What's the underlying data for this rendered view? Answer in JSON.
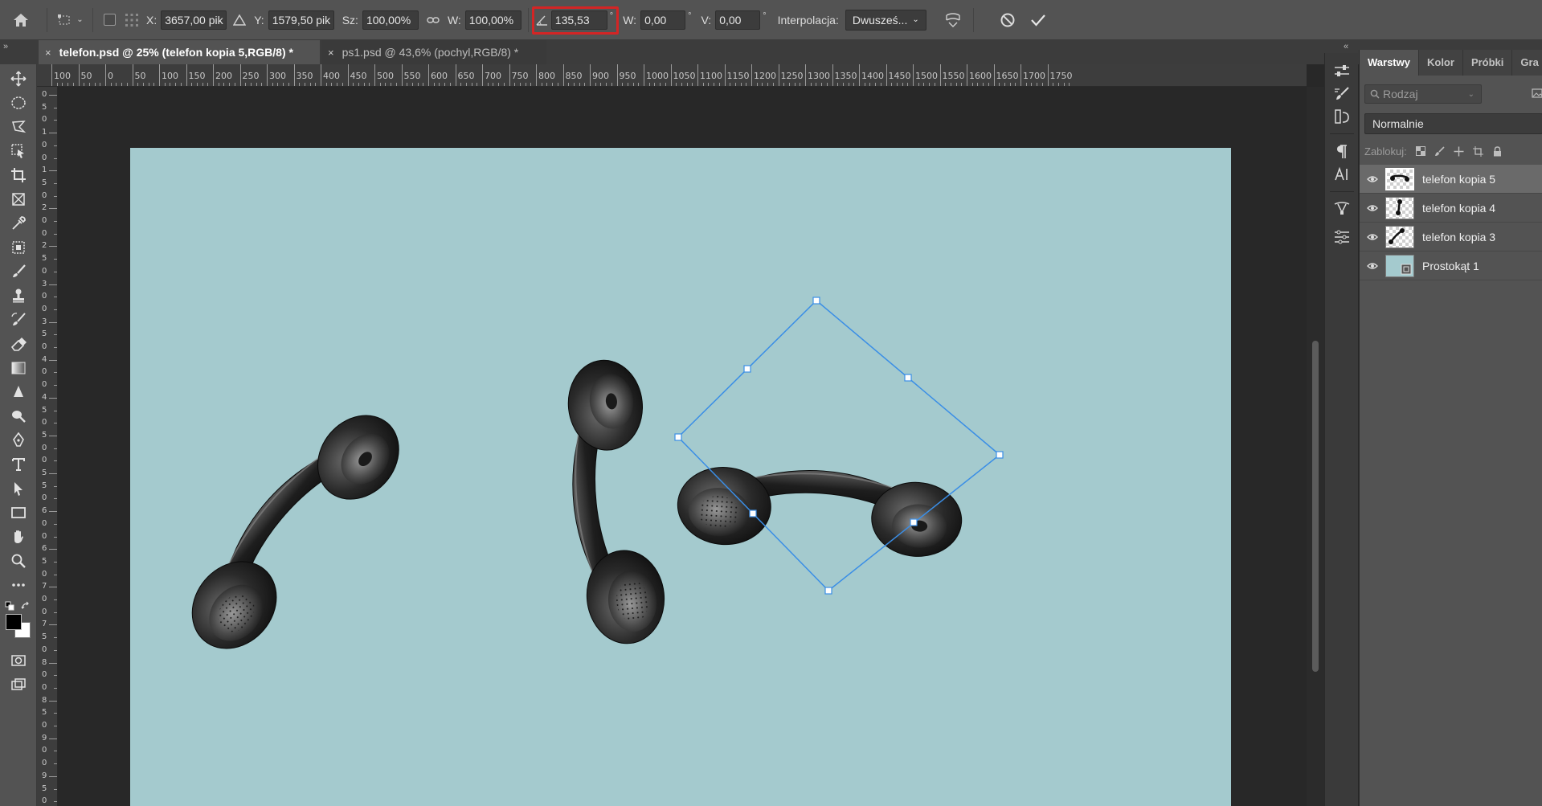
{
  "options_bar": {
    "x_label": "X:",
    "x_value": "3657,00 pik",
    "y_label": "Y:",
    "y_value": "1579,50 pik",
    "width_label": "Sz:",
    "width_value": "100,00%",
    "height_label": "W:",
    "height_value": "100,00%",
    "angle_value": "135,53",
    "angle_unit": "°",
    "hskew_label": "W:",
    "hskew_value": "0,00",
    "hskew_unit": "°",
    "vskew_label": "V:",
    "vskew_value": "0,00",
    "vskew_unit": "°",
    "interpolation_label": "Interpolacja:",
    "interpolation_value": "Dwusześ...",
    "highlight_color": "#d42525"
  },
  "tabs": [
    {
      "close": "×",
      "label": "telefon.psd @ 25% (telefon kopia 5,RGB/8) *",
      "active": true
    },
    {
      "close": "×",
      "label": "ps1.psd @ 43,6% (pochyl,RGB/8) *",
      "active": false
    }
  ],
  "ruler_top": [
    "100",
    "50",
    "0",
    "50",
    "100",
    "150",
    "200",
    "250",
    "300",
    "350",
    "400",
    "450",
    "500",
    "550",
    "600",
    "650",
    "700",
    "750",
    "800",
    "850",
    "900",
    "950",
    "1000",
    "1050",
    "1100",
    "1150",
    "1200",
    "1250",
    "1300",
    "1350",
    "1400",
    "1450",
    "1500",
    "1550",
    "1600",
    "1650",
    "1700",
    "1750"
  ],
  "ruler_left": [
    "0",
    "5",
    "0",
    "1",
    "0",
    "0",
    "1",
    "5",
    "0",
    "2",
    "0",
    "0",
    "2",
    "5",
    "0",
    "3",
    "0",
    "0",
    "3",
    "5",
    "0",
    "4",
    "0",
    "0",
    "4",
    "5",
    "0",
    "5",
    "0",
    "0",
    "5",
    "5",
    "0",
    "6",
    "0",
    "0",
    "6",
    "5",
    "0",
    "7",
    "0",
    "0",
    "7",
    "5",
    "0",
    "8",
    "0",
    "0",
    "8",
    "5",
    "0",
    "9",
    "0",
    "0",
    "9",
    "5",
    "0"
  ],
  "canvas": {
    "background": "#a4cace",
    "selection_color": "#3a8ee6"
  },
  "panel": {
    "tabs": [
      "Warstwy",
      "Kolor",
      "Próbki",
      "Gra"
    ],
    "filter_placeholder": "Rodzaj",
    "blend_mode": "Normalnie",
    "lock_label": "Zablokuj:",
    "layers": [
      {
        "name": "telefon kopia 5",
        "selected": true
      },
      {
        "name": "telefon kopia 4",
        "selected": false
      },
      {
        "name": "telefon kopia 3",
        "selected": false
      },
      {
        "name": "Prostokąt 1",
        "selected": false
      }
    ]
  },
  "tools": [
    "move-tool-icon",
    "ellipse-marquee-icon",
    "lasso-icon",
    "object-select-icon",
    "crop-icon",
    "frame-icon",
    "eyedropper-icon",
    "patch-icon",
    "brush-icon",
    "stamp-icon",
    "history-brush-icon",
    "eraser-icon",
    "gradient-icon",
    "blur-icon",
    "dodge-icon",
    "pen-icon",
    "type-icon",
    "path-select-icon",
    "rectangle-icon",
    "hand-icon",
    "zoom-icon",
    "more-icon"
  ]
}
